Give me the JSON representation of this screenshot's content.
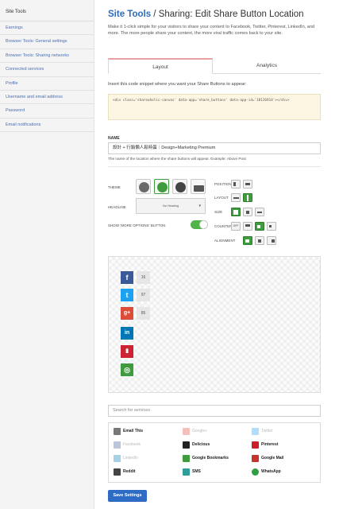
{
  "sidebar": {
    "title": "Site Tools",
    "items": [
      {
        "label": "Earnings"
      },
      {
        "label": "Browser Tools: General settings"
      },
      {
        "label": "Browser Tools: Sharing networks"
      },
      {
        "label": "Connected services"
      },
      {
        "label": "Profile"
      },
      {
        "label": "Username and email address"
      },
      {
        "label": "Password"
      },
      {
        "label": "Email notifications"
      }
    ]
  },
  "header": {
    "title_primary": "Site Tools",
    "title_secondary": " / Sharing: Edit Share Button Location",
    "intro": "Make it 1-click simple for your visitors to share your content to Facebook, Twitter, Pinterest, LinkedIn, and more. The more people share your content, the more viral traffic comes back to your site."
  },
  "tabs": [
    {
      "label": "Layout",
      "active": true
    },
    {
      "label": "Analytics",
      "active": false
    }
  ],
  "snippet": {
    "label": "Insert this code snippet where you want your Share Buttons to appear:",
    "code": "<div class='shareaholic-canvas' data-app='share_buttons' data-app-id='18126914'></div>"
  },
  "name_field": {
    "label": "NAME",
    "value": "設計 + 行銷懶人鬆時蛋｜Design+Marketing Premium",
    "help": "The name of the location where the share buttons will appear. Example: Above Post"
  },
  "settings": {
    "theme_label": "THEME",
    "headline_label": "HEADLINE",
    "headline_value": "No Heading",
    "more_options_label": "SHOW 'MORE OPTIONS' BUTTON",
    "more_options_on": true,
    "position_label": "POSITION",
    "layout_label": "LAYOUT",
    "size_label": "SIZE",
    "counter_label": "COUNTER",
    "counter_off_label": "OFF",
    "alignment_label": "ALIGNMENT"
  },
  "preview": {
    "buttons": [
      {
        "name": "Facebook",
        "icon": "facebook-icon",
        "glyph": "f",
        "color": "#3b5998",
        "count": "16"
      },
      {
        "name": "Twitter",
        "icon": "twitter-icon",
        "glyph": "t",
        "color": "#1da1f2",
        "count": "97"
      },
      {
        "name": "Google+",
        "icon": "google-plus-icon",
        "glyph": "g+",
        "color": "#dd4b39",
        "count": "85"
      },
      {
        "name": "LinkedIn",
        "icon": "linkedin-icon",
        "glyph": "in",
        "color": "#0077b5"
      },
      {
        "name": "Bookmark",
        "icon": "bookmark-icon",
        "glyph": "▮",
        "color": "#cc2233"
      },
      {
        "name": "Shareaholic",
        "icon": "shareaholic-icon",
        "glyph": "◎",
        "color": "#3f9b3d"
      }
    ]
  },
  "services": {
    "search_placeholder": "Search for services",
    "items": [
      {
        "label": "Email This",
        "icon": "email-icon",
        "color": "#777777",
        "enabled": true
      },
      {
        "label": "Google+",
        "icon": "google-plus-icon",
        "color": "#dd4b39",
        "enabled": false
      },
      {
        "label": "Twitter",
        "icon": "twitter-icon",
        "color": "#1da1f2",
        "enabled": false
      },
      {
        "label": "Facebook",
        "icon": "facebook-icon",
        "color": "#3b5998",
        "enabled": false
      },
      {
        "label": "Delicious",
        "icon": "delicious-icon",
        "color": "#222222",
        "enabled": true
      },
      {
        "label": "Pinterest",
        "icon": "pinterest-icon",
        "color": "#cb2027",
        "enabled": true
      },
      {
        "label": "LinkedIn",
        "icon": "linkedin-icon",
        "color": "#0077b5",
        "enabled": false
      },
      {
        "label": "Google Bookmarks",
        "icon": "google-bookmarks-icon",
        "color": "#3f9b3d",
        "enabled": true
      },
      {
        "label": "Google Mail",
        "icon": "gmail-icon",
        "color": "#c5352b",
        "enabled": true
      },
      {
        "label": "Reddit",
        "icon": "reddit-icon",
        "color": "#444444",
        "enabled": true
      },
      {
        "label": "SMS",
        "icon": "sms-icon",
        "color": "#2f9d9a",
        "enabled": true
      },
      {
        "label": "WhatsApp",
        "icon": "whatsapp-icon",
        "color": "#2ea043",
        "enabled": true
      }
    ]
  },
  "actions": {
    "save_label": "Save Settings"
  }
}
